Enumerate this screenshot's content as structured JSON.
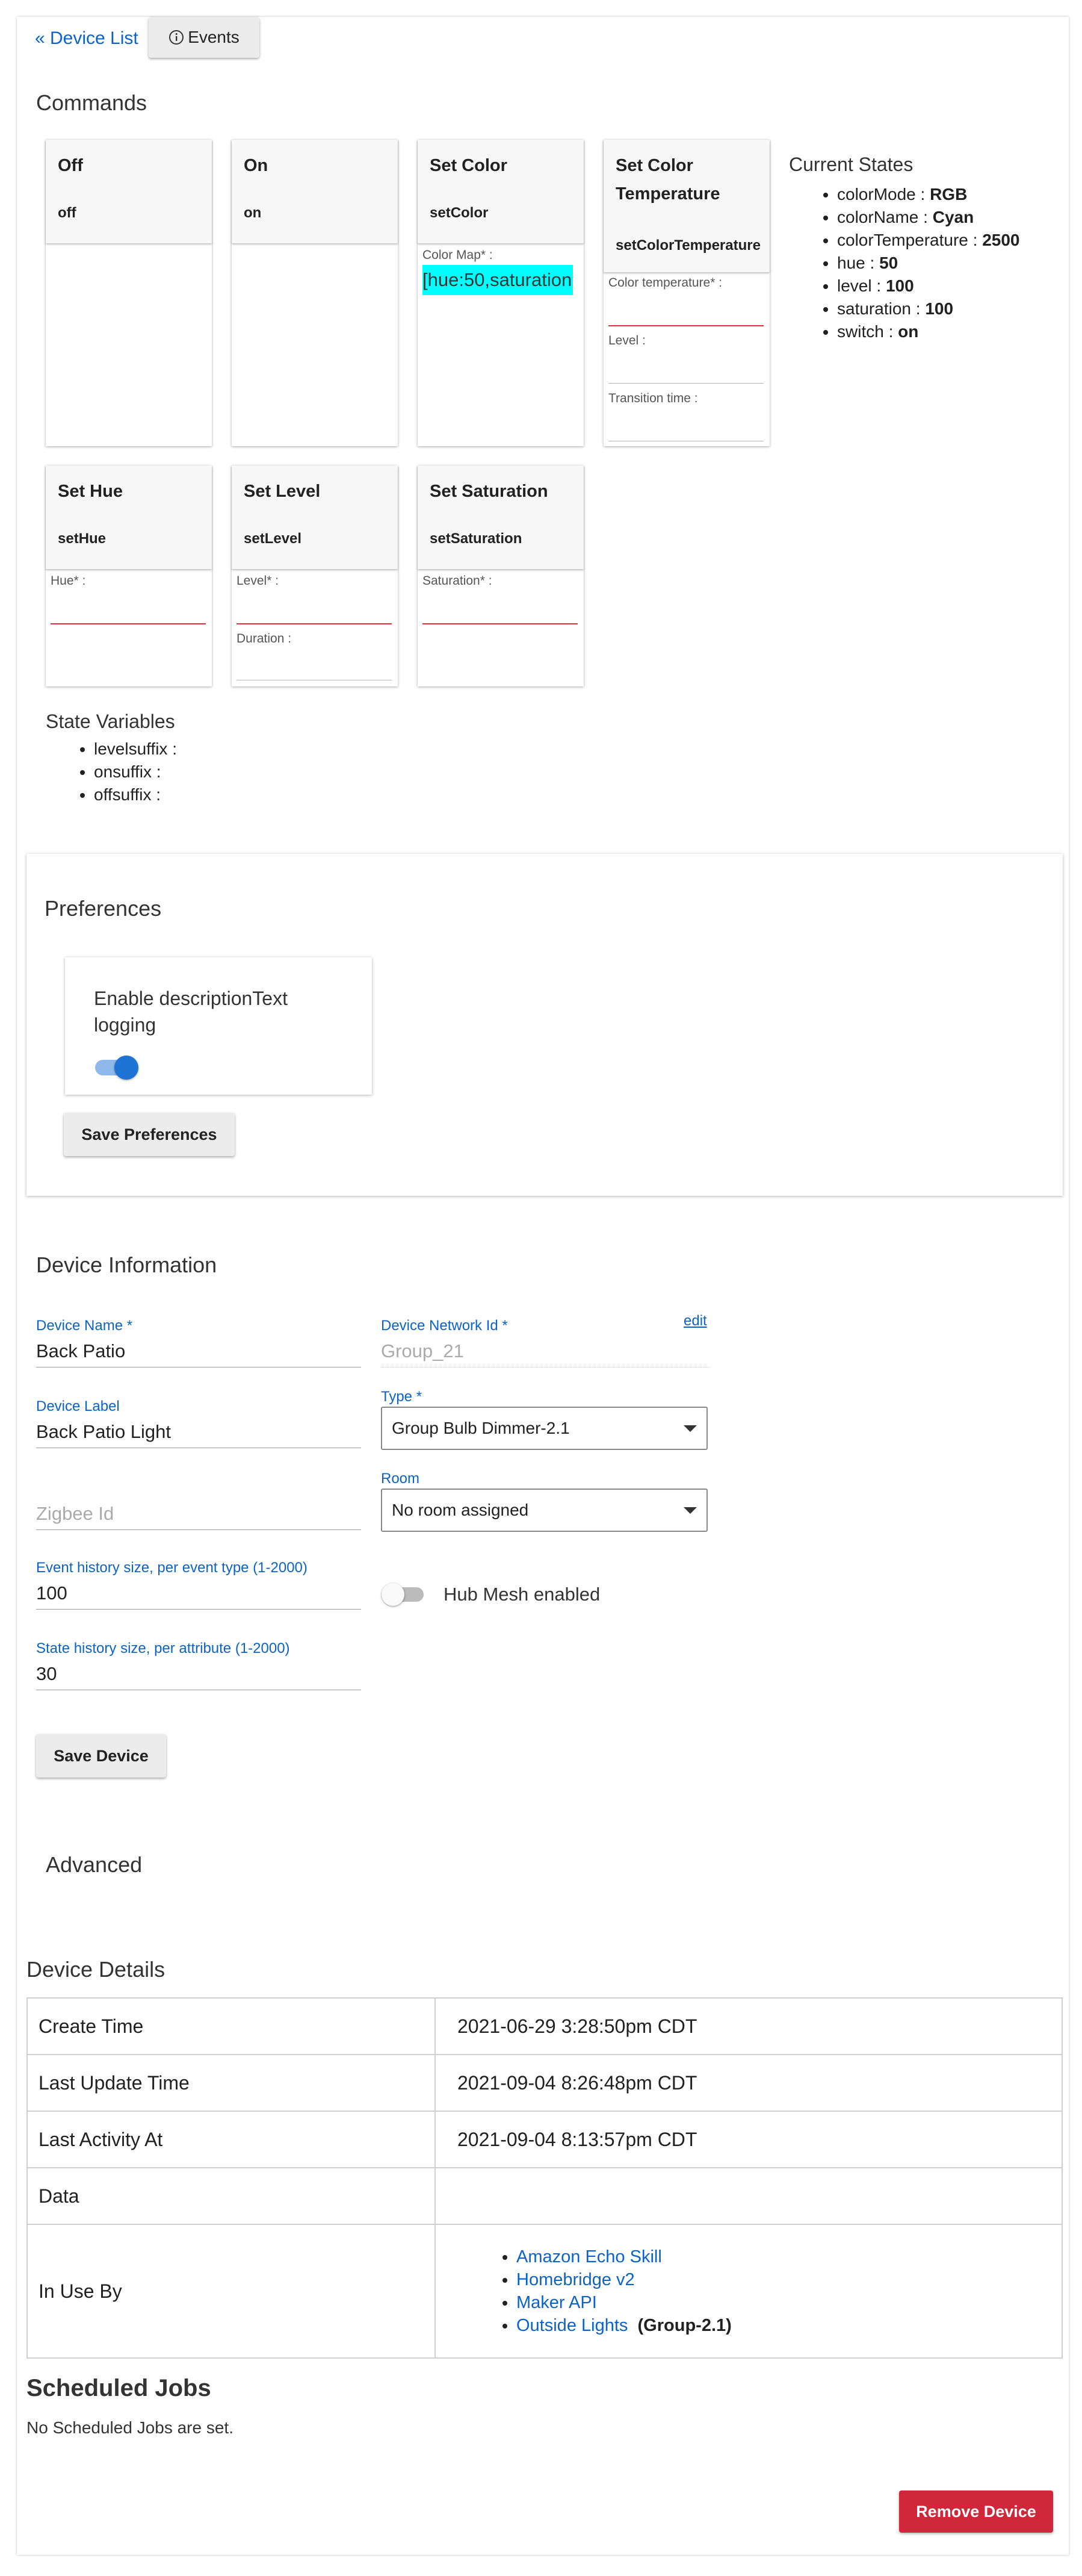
{
  "nav": {
    "device_list": "« Device List",
    "events": "Events"
  },
  "commands": {
    "title": "Commands",
    "cards": [
      {
        "title": "Off",
        "command": "off"
      },
      {
        "title": "On",
        "command": "on"
      },
      {
        "title": "Set Color",
        "command": "setColor",
        "fields": [
          {
            "label": "Color Map* :",
            "value": "[hue:50,saturation"
          }
        ]
      },
      {
        "title": "Set Color Temperature",
        "command": "setColorTemperature",
        "fields": [
          {
            "label": "Color temperature* :"
          },
          {
            "label": "Level :"
          },
          {
            "label": "Transition time :"
          }
        ]
      },
      {
        "title": "Set Hue",
        "command": "setHue",
        "fields": [
          {
            "label": "Hue* :"
          }
        ]
      },
      {
        "title": "Set Level",
        "command": "setLevel",
        "fields": [
          {
            "label": "Level* :"
          },
          {
            "label": "Duration :"
          }
        ]
      },
      {
        "title": "Set Saturation",
        "command": "setSaturation",
        "fields": [
          {
            "label": "Saturation* :"
          }
        ]
      }
    ]
  },
  "current_states": {
    "title": "Current States",
    "items": [
      {
        "name": "colorMode",
        "value": "RGB"
      },
      {
        "name": "colorName",
        "value": "Cyan"
      },
      {
        "name": "colorTemperature",
        "value": "2500"
      },
      {
        "name": "hue",
        "value": "50"
      },
      {
        "name": "level",
        "value": "100"
      },
      {
        "name": "saturation",
        "value": "100"
      },
      {
        "name": "switch",
        "value": "on"
      }
    ]
  },
  "state_variables": {
    "title": "State Variables",
    "items": [
      "levelsuffix :",
      "onsuffix :",
      "offsuffix :"
    ]
  },
  "preferences": {
    "title": "Preferences",
    "toggle_label": "Enable descriptionText logging",
    "toggle_on": true,
    "save_label": "Save Preferences"
  },
  "device_info": {
    "title": "Device Information",
    "device_name_label": "Device Name *",
    "device_name": "Back Patio",
    "network_id_label": "Device Network Id *",
    "network_id": "Group_21",
    "edit_label": "edit",
    "device_label_label": "Device Label",
    "device_label": "Back Patio Light",
    "type_label": "Type *",
    "type_value": "Group Bulb Dimmer-2.1",
    "zigbee_placeholder": "Zigbee Id",
    "room_label": "Room",
    "room_value": "No room assigned",
    "event_history_label": "Event history size, per event type (1-2000)",
    "event_history": "100",
    "hub_mesh_label": "Hub Mesh enabled",
    "hub_mesh_on": false,
    "state_history_label": "State history size, per attribute (1-2000)",
    "state_history": "30",
    "save_label": "Save Device"
  },
  "advanced": {
    "title": "Advanced"
  },
  "device_details": {
    "title": "Device Details",
    "rows": [
      {
        "label": "Create Time",
        "value": "2021-06-29 3:28:50pm CDT"
      },
      {
        "label": "Last Update Time",
        "value": "2021-09-04 8:26:48pm CDT"
      },
      {
        "label": "Last Activity At",
        "value": "2021-09-04 8:13:57pm CDT"
      },
      {
        "label": "Data",
        "value": ""
      }
    ],
    "in_use_by_label": "In Use By",
    "in_use_by": [
      {
        "name": "Amazon Echo Skill",
        "suffix": ""
      },
      {
        "name": "Homebridge v2",
        "suffix": ""
      },
      {
        "name": "Maker API",
        "suffix": ""
      },
      {
        "name": "Outside Lights",
        "suffix": "(Group-2.1)"
      }
    ]
  },
  "scheduled_jobs": {
    "title": "Scheduled Jobs",
    "empty_text": "No Scheduled Jobs are set."
  },
  "remove_label": "Remove Device",
  "colors": {
    "link": "#0b63c9",
    "danger": "#d0283a",
    "toggle": "#1e74d4",
    "required_underline": "#e02f3f",
    "highlight": "#00ffff"
  },
  "icons": {
    "events": "info-circle-icon",
    "select": "caret-down-icon"
  }
}
